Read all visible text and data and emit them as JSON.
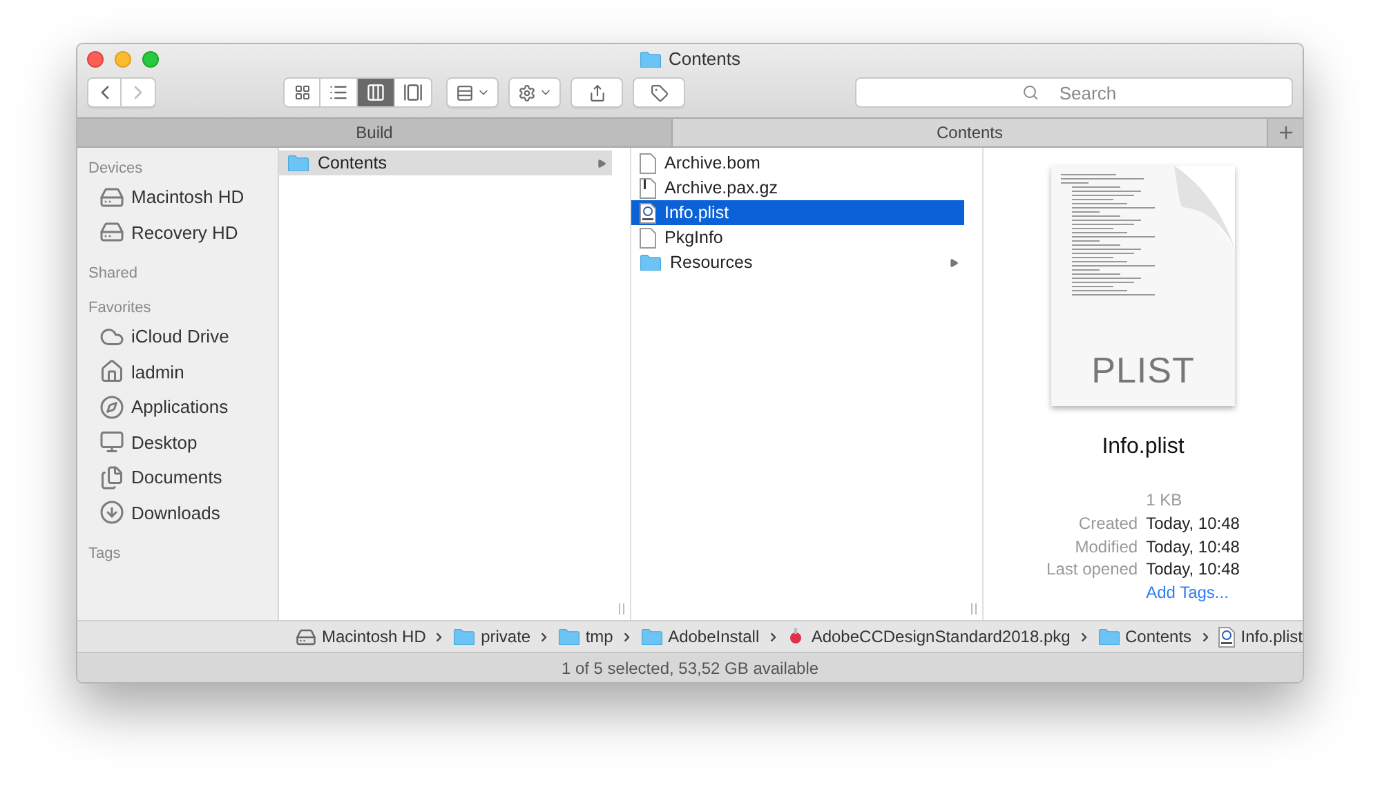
{
  "window": {
    "title": "Contents"
  },
  "toolbar": {
    "nav": [
      {
        "kind": "back",
        "disabled": false
      },
      {
        "kind": "forward",
        "disabled": true
      }
    ],
    "view_modes": [
      {
        "kind": "icons",
        "selected": false
      },
      {
        "kind": "list",
        "selected": false
      },
      {
        "kind": "columns",
        "selected": true
      },
      {
        "kind": "gallery",
        "selected": false
      }
    ],
    "search": {
      "placeholder": "Search"
    }
  },
  "tabs": [
    {
      "label": "Build",
      "selected": false
    },
    {
      "label": "Contents",
      "selected": true
    }
  ],
  "sidebar": {
    "sections": [
      {
        "title": "Devices",
        "items": [
          {
            "label": "Macintosh HD",
            "kind": "disk"
          },
          {
            "label": "Recovery HD",
            "kind": "disk"
          }
        ]
      },
      {
        "title": "Shared"
      },
      {
        "title": "Favorites",
        "items": [
          {
            "label": "iCloud Drive",
            "kind": "cloud"
          },
          {
            "label": "ladmin",
            "kind": "home"
          },
          {
            "label": "Applications",
            "kind": "apps"
          },
          {
            "label": "Desktop",
            "kind": "desktop"
          },
          {
            "label": "Documents",
            "kind": "documents"
          },
          {
            "label": "Downloads",
            "kind": "downloads"
          }
        ]
      },
      {
        "title": "Tags"
      }
    ]
  },
  "columns": [
    {
      "active": false,
      "items": [
        {
          "name": "Contents",
          "kind": "folder",
          "selected": true,
          "has_children": true
        }
      ]
    },
    {
      "active": true,
      "items": [
        {
          "name": "Archive.bom",
          "kind": "file",
          "selected": false,
          "has_children": false
        },
        {
          "name": "Archive.pax.gz",
          "kind": "archive",
          "selected": false,
          "has_children": false
        },
        {
          "name": "Info.plist",
          "kind": "plist",
          "selected": true,
          "has_children": false
        },
        {
          "name": "PkgInfo",
          "kind": "file",
          "selected": false,
          "has_children": false
        },
        {
          "name": "Resources",
          "kind": "folder",
          "selected": false,
          "has_children": true
        }
      ]
    }
  ],
  "preview": {
    "type_label": "PLIST",
    "name": "Info.plist",
    "size": "1 KB",
    "info": [
      {
        "label": "Created",
        "value": "Today, 10:48"
      },
      {
        "label": "Modified",
        "value": "Today, 10:48"
      },
      {
        "label": "Last opened",
        "value": "Today, 10:48"
      }
    ],
    "add_tags": "Add Tags..."
  },
  "path_bar": [
    {
      "name": "Macintosh HD",
      "kind": "disk"
    },
    {
      "name": "private",
      "kind": "folder"
    },
    {
      "name": "tmp",
      "kind": "folder"
    },
    {
      "name": "AdobeInstall",
      "kind": "folder"
    },
    {
      "name": "AdobeCCDesignStandard2018.pkg",
      "kind": "package"
    },
    {
      "name": "Contents",
      "kind": "folder"
    },
    {
      "name": "Info.plist",
      "kind": "plist"
    }
  ],
  "status_bar": "1 of 5 selected, 53,52 GB available"
}
